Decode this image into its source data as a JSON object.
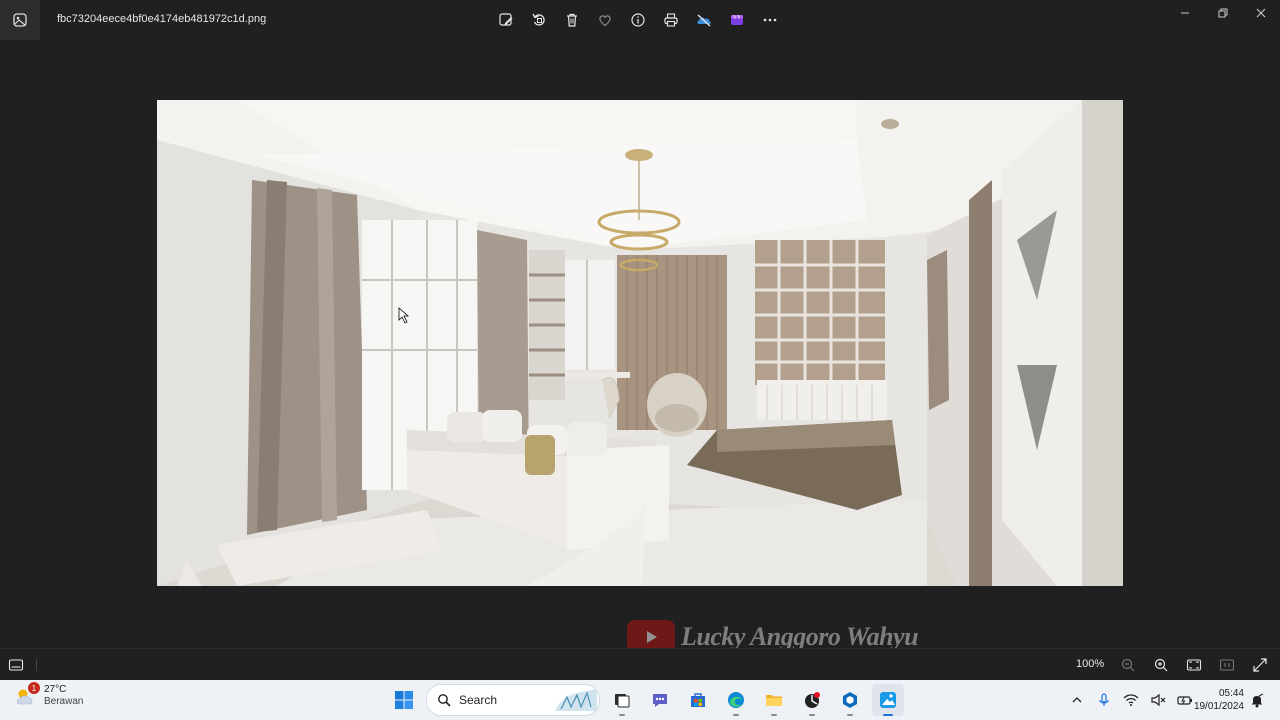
{
  "window": {
    "title": "fbc73204eece4bf0e4174eb481972c1d.png",
    "controls": [
      "minimize",
      "restore",
      "close"
    ]
  },
  "toolbar": {
    "items": [
      {
        "icon": "edit-image-icon"
      },
      {
        "icon": "rotate-icon"
      },
      {
        "icon": "delete-icon"
      },
      {
        "icon": "favorite-icon"
      },
      {
        "icon": "info-icon"
      },
      {
        "icon": "print-icon"
      },
      {
        "icon": "onedrive-off-icon"
      },
      {
        "icon": "clipchamp-icon"
      },
      {
        "icon": "more-icon"
      }
    ]
  },
  "image": {
    "subject": "interior-render"
  },
  "watermark": {
    "text": "Lucky Anggoro Wahyu"
  },
  "statusbar": {
    "zoom": "100%"
  },
  "taskbar": {
    "weather": {
      "temp": "27°C",
      "desc": "Berawan",
      "badge": "1"
    },
    "search_label": "Search",
    "clock": {
      "time": "05:44",
      "date": "19/01/2024"
    }
  },
  "colors": {
    "bg": "#202020",
    "taskbar": "#eef1f6",
    "accent": "#1a73d9",
    "watermark_red": "#a31414"
  }
}
